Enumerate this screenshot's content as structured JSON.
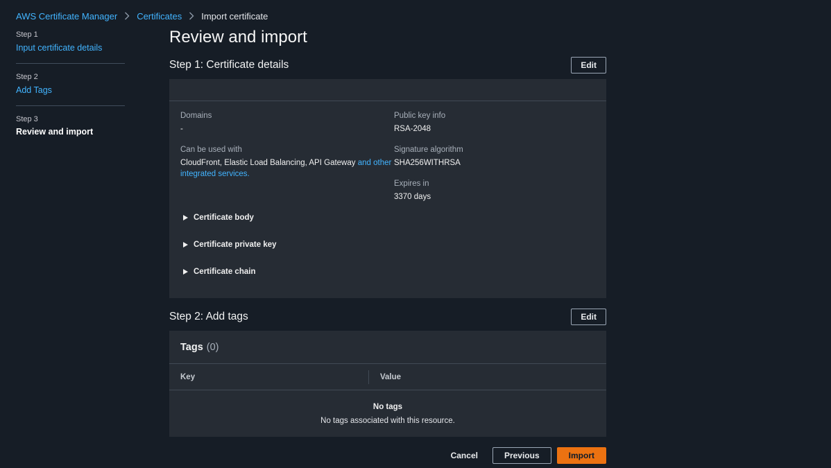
{
  "breadcrumb": {
    "items": [
      "AWS Certificate Manager",
      "Certificates"
    ],
    "current": "Import certificate"
  },
  "stepnav": {
    "steps": [
      {
        "num": "Step 1",
        "label": "Input certificate details"
      },
      {
        "num": "Step 2",
        "label": "Add Tags"
      },
      {
        "num": "Step 3",
        "label": "Review and import"
      }
    ]
  },
  "page": {
    "title": "Review and import"
  },
  "step1": {
    "title": "Step 1: Certificate details",
    "edit_label": "Edit",
    "domains_label": "Domains",
    "domains_value": "-",
    "usedwith_label": "Can be used with",
    "usedwith_value": "CloudFront, Elastic Load Balancing, API Gateway",
    "usedwith_link": "and other integrated services.",
    "pubkey_label": "Public key info",
    "pubkey_value": "RSA-2048",
    "sigalg_label": "Signature algorithm",
    "sigalg_value": "SHA256WITHRSA",
    "expires_label": "Expires in",
    "expires_value": "3370 days",
    "expanders": [
      "Certificate body",
      "Certificate private key",
      "Certificate chain"
    ]
  },
  "step2": {
    "title": "Step 2: Add tags",
    "edit_label": "Edit",
    "tags_title": "Tags",
    "tags_count": "(0)",
    "col_key": "Key",
    "col_value": "Value",
    "empty_title": "No tags",
    "empty_desc": "No tags associated with this resource."
  },
  "actions": {
    "cancel": "Cancel",
    "previous": "Previous",
    "import": "Import"
  },
  "colors": {
    "background": "#161d26",
    "panel": "#262c34",
    "link": "#42b4ff",
    "primary": "#ec7211"
  }
}
